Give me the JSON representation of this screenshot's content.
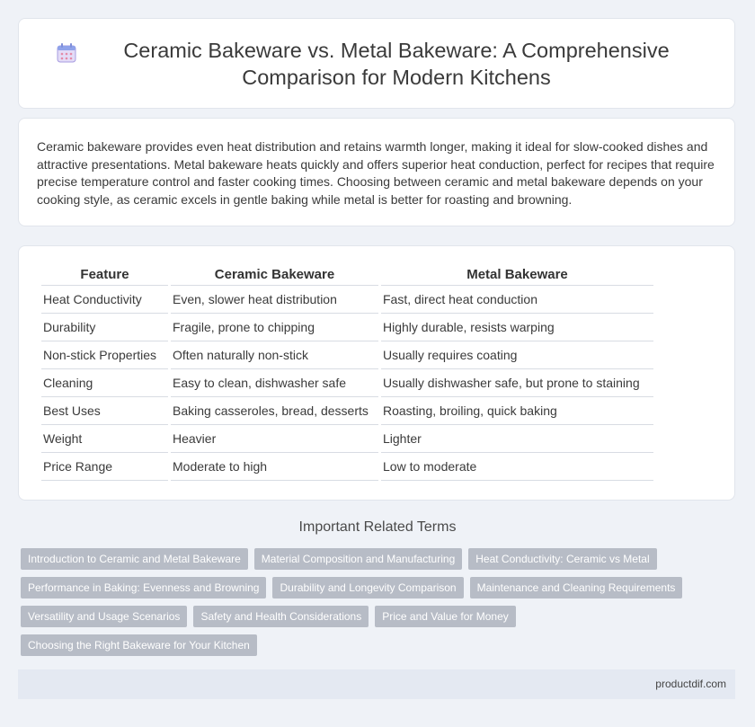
{
  "header": {
    "icon": "calendar-icon",
    "title": "Ceramic Bakeware vs. Metal Bakeware: A Comprehensive Comparison for Modern Kitchens"
  },
  "intro": {
    "text": "Ceramic bakeware provides even heat distribution and retains warmth longer, making it ideal for slow-cooked dishes and attractive presentations. Metal bakeware heats quickly and offers superior heat conduction, perfect for recipes that require precise temperature control and faster cooking times. Choosing between ceramic and metal bakeware depends on your cooking style, as ceramic excels in gentle baking while metal is better for roasting and browning."
  },
  "table": {
    "headers": [
      "Feature",
      "Ceramic Bakeware",
      "Metal Bakeware"
    ],
    "rows": [
      [
        "Heat Conductivity",
        "Even, slower heat distribution",
        "Fast, direct heat conduction"
      ],
      [
        "Durability",
        "Fragile, prone to chipping",
        "Highly durable, resists warping"
      ],
      [
        "Non-stick Properties",
        "Often naturally non-stick",
        "Usually requires coating"
      ],
      [
        "Cleaning",
        "Easy to clean, dishwasher safe",
        "Usually dishwasher safe, but prone to staining"
      ],
      [
        "Best Uses",
        "Baking casseroles, bread, desserts",
        "Roasting, broiling, quick baking"
      ],
      [
        "Weight",
        "Heavier",
        "Lighter"
      ],
      [
        "Price Range",
        "Moderate to high",
        "Low to moderate"
      ]
    ]
  },
  "related": {
    "title": "Important Related Terms",
    "tags": [
      "Introduction to Ceramic and Metal Bakeware",
      "Material Composition and Manufacturing",
      "Heat Conductivity: Ceramic vs Metal",
      "Performance in Baking: Evenness and Browning",
      "Durability and Longevity Comparison",
      "Maintenance and Cleaning Requirements",
      "Versatility and Usage Scenarios",
      "Safety and Health Considerations",
      "Price and Value for Money",
      "Choosing the Right Bakeware for Your Kitchen"
    ]
  },
  "footer": {
    "site": "productdif.com"
  },
  "colors": {
    "background": "#eff2f7",
    "tag_background": "#b7bcc6",
    "footer_background": "#e4e9f2"
  }
}
